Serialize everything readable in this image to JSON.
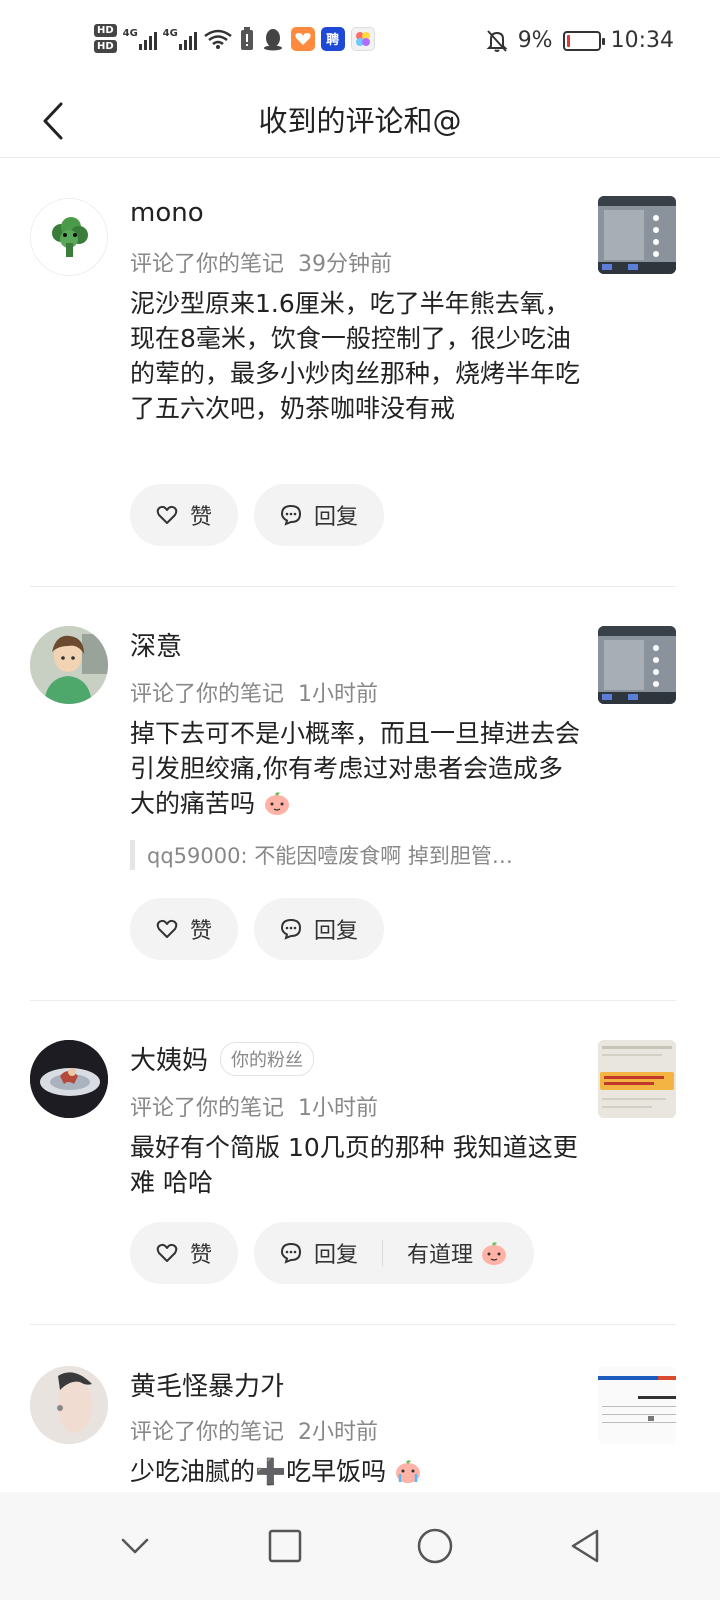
{
  "status_bar": {
    "hd1": "HD",
    "hd2": "HD",
    "net1": "4G",
    "net2": "4G",
    "battery_percent": "9%",
    "time": "10:34",
    "battery_level": 0.09,
    "battery_color": "#e53935"
  },
  "header": {
    "title": "收到的评论和@"
  },
  "comments": [
    {
      "username": "mono",
      "badge": "",
      "action": "评论了你的笔记",
      "time": "39分钟前",
      "text": "泥沙型原来1.6厘米，吃了半年熊去氧，现在8毫米，饮食一般控制了，很少吃油的荤的，最多小炒肉丝那种，烧烤半年吃了五六次吧，奶茶咖啡没有戒",
      "quote": "",
      "like_label": "赞",
      "reply_label": "回复",
      "extra_label": ""
    },
    {
      "username": "深意",
      "badge": "",
      "action": "评论了你的笔记",
      "time": "1小时前",
      "text": "掉下去可不是小概率，而且一旦掉进去会引发胆绞痛,你有考虑过对患者会造成多大的痛苦吗",
      "quote": "qq59000: 不能因噎废食啊   掉到胆管…",
      "like_label": "赞",
      "reply_label": "回复",
      "extra_label": ""
    },
    {
      "username": "大姨妈",
      "badge": "你的粉丝",
      "action": "评论了你的笔记",
      "time": "1小时前",
      "text": "最好有个简版 10几页的那种 我知道这更难 哈哈",
      "quote": "",
      "like_label": "赞",
      "reply_label": "回复",
      "extra_label": "有道理"
    },
    {
      "username": "黄毛怪暴力가",
      "badge": "",
      "action": "评论了你的笔记",
      "time": "2小时前",
      "text": "少吃油腻的➕吃早饭吗",
      "quote": "",
      "like_label": "",
      "reply_label": "",
      "extra_label": ""
    }
  ]
}
